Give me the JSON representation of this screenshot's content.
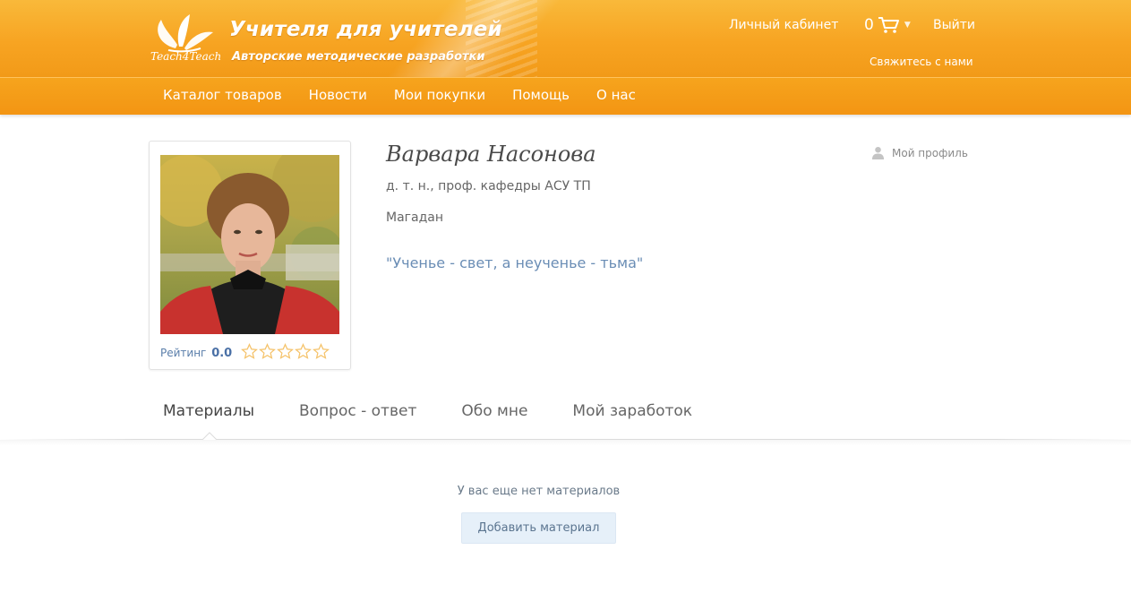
{
  "header": {
    "brand_title": "Учителя для учителей",
    "brand_subtitle": "Авторские методические разработки",
    "logo_text": "Teach4Teach",
    "cabinet_label": "Личный кабинет",
    "cart_count": "0",
    "logout_label": "Выйти",
    "contact_label": "Свяжитесь с нами"
  },
  "nav": {
    "items": [
      {
        "label": "Каталог товаров"
      },
      {
        "label": "Новости"
      },
      {
        "label": "Мои покупки"
      },
      {
        "label": "Помощь"
      },
      {
        "label": "О нас"
      }
    ]
  },
  "profile": {
    "name": "Варвара Насонова",
    "title": "д. т. н., проф. кафедры АСУ ТП",
    "city": "Магадан",
    "quote": "\"Ученье - свет, а неученье - тьма\"",
    "rating_label": "Рейтинг",
    "rating_value": "0.0",
    "stars_filled": 0,
    "stars_total": 5,
    "my_profile_label": "Мой профиль"
  },
  "tabs": [
    {
      "label": "Материалы",
      "active": true
    },
    {
      "label": "Вопрос - ответ",
      "active": false
    },
    {
      "label": "Обо мне",
      "active": false
    },
    {
      "label": "Мой заработок",
      "active": false
    }
  ],
  "materials": {
    "empty_message": "У вас еще нет материалов",
    "add_button_label": "Добавить материал"
  },
  "colors": {
    "header_orange": "#f7a422",
    "nav_orange": "#f39513",
    "link_blue": "#6a8db5",
    "button_bg": "#e6f0f9",
    "star_outline": "#f5c36b"
  }
}
